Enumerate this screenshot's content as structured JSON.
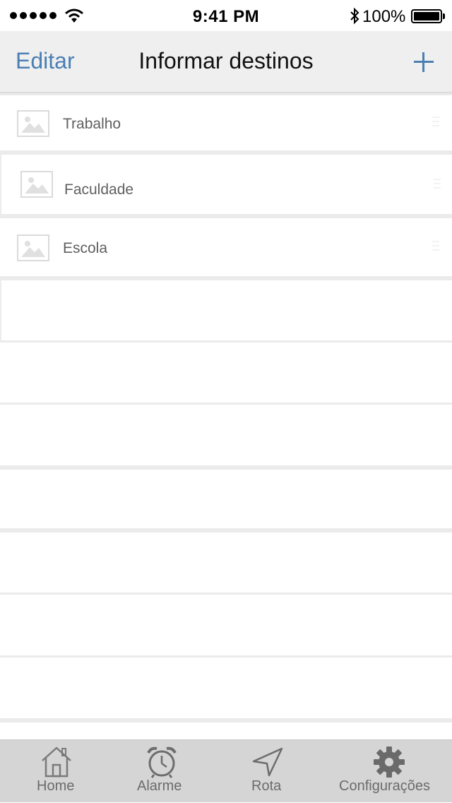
{
  "status_bar": {
    "time": "9:41 PM",
    "battery_percent": "100%"
  },
  "nav": {
    "edit_label": "Editar",
    "title": "Informar destinos",
    "add_icon": "plus-icon"
  },
  "destinations": [
    {
      "label": "Trabalho",
      "icon": "image-placeholder-icon"
    },
    {
      "label": "Faculdade",
      "icon": "image-placeholder-icon"
    },
    {
      "label": "Escola",
      "icon": "image-placeholder-icon"
    }
  ],
  "tabs": [
    {
      "label": "Home",
      "icon": "home-icon"
    },
    {
      "label": "Alarme",
      "icon": "alarm-clock-icon"
    },
    {
      "label": "Rota",
      "icon": "navigation-arrow-icon"
    },
    {
      "label": "Configurações",
      "icon": "gear-icon"
    }
  ],
  "colors": {
    "accent": "#4a7fb3",
    "nav_background": "#efefef",
    "tab_background": "#d5d5d5"
  }
}
